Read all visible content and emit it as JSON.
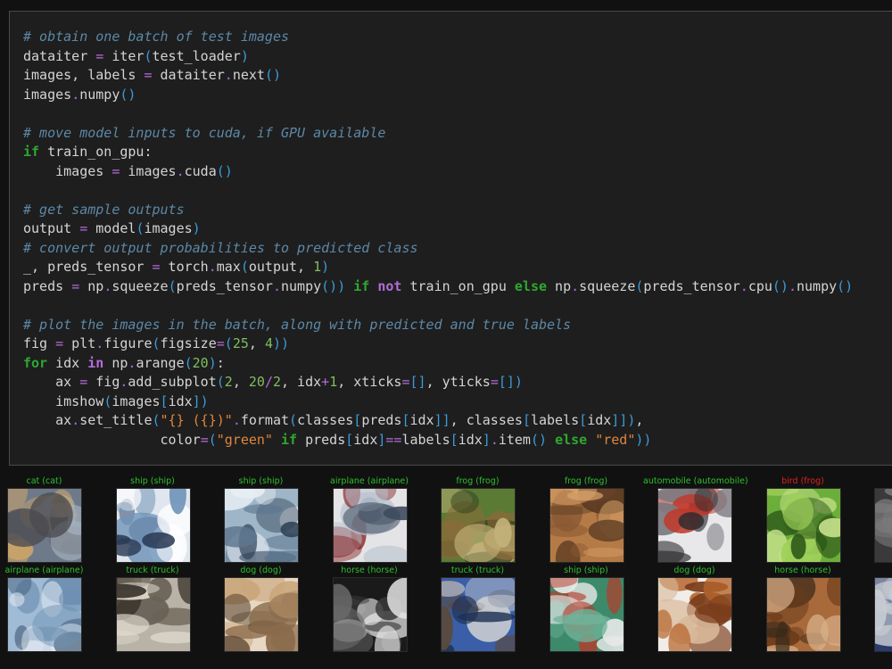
{
  "code_lines": [
    [
      {
        "c": "cm",
        "t": "# obtain one batch of test images"
      }
    ],
    [
      {
        "t": "dataiter "
      },
      {
        "c": "op",
        "t": "="
      },
      {
        "t": " iter"
      },
      {
        "c": "br",
        "t": "("
      },
      {
        "t": "test_loader"
      },
      {
        "c": "br",
        "t": ")"
      }
    ],
    [
      {
        "t": "images, labels "
      },
      {
        "c": "op",
        "t": "="
      },
      {
        "t": " dataiter"
      },
      {
        "c": "op",
        "t": "."
      },
      {
        "t": "next"
      },
      {
        "c": "br",
        "t": "()"
      }
    ],
    [
      {
        "t": "images"
      },
      {
        "c": "op",
        "t": "."
      },
      {
        "t": "numpy"
      },
      {
        "c": "br",
        "t": "()"
      }
    ],
    [
      {
        "t": ""
      }
    ],
    [
      {
        "c": "cm",
        "t": "# move model inputs to cuda, if GPU available"
      }
    ],
    [
      {
        "c": "kw",
        "t": "if"
      },
      {
        "t": " train_on_gpu:"
      }
    ],
    [
      {
        "t": "    images "
      },
      {
        "c": "op",
        "t": "="
      },
      {
        "t": " images"
      },
      {
        "c": "op",
        "t": "."
      },
      {
        "t": "cuda"
      },
      {
        "c": "br",
        "t": "()"
      }
    ],
    [
      {
        "t": ""
      }
    ],
    [
      {
        "c": "cm",
        "t": "# get sample outputs"
      }
    ],
    [
      {
        "t": "output "
      },
      {
        "c": "op",
        "t": "="
      },
      {
        "t": " model"
      },
      {
        "c": "br",
        "t": "("
      },
      {
        "t": "images"
      },
      {
        "c": "br",
        "t": ")"
      }
    ],
    [
      {
        "c": "cm",
        "t": "# convert output probabilities to predicted class"
      }
    ],
    [
      {
        "t": "_, preds_tensor "
      },
      {
        "c": "op",
        "t": "="
      },
      {
        "t": " torch"
      },
      {
        "c": "op",
        "t": "."
      },
      {
        "t": "max"
      },
      {
        "c": "br",
        "t": "("
      },
      {
        "t": "output, "
      },
      {
        "c": "num",
        "t": "1"
      },
      {
        "c": "br",
        "t": ")"
      }
    ],
    [
      {
        "t": "preds "
      },
      {
        "c": "op",
        "t": "="
      },
      {
        "t": " np"
      },
      {
        "c": "op",
        "t": "."
      },
      {
        "t": "squeeze"
      },
      {
        "c": "br",
        "t": "("
      },
      {
        "t": "preds_tensor"
      },
      {
        "c": "op",
        "t": "."
      },
      {
        "t": "numpy"
      },
      {
        "c": "br",
        "t": "())"
      },
      {
        "t": " "
      },
      {
        "c": "kw",
        "t": "if"
      },
      {
        "t": " "
      },
      {
        "c": "kw2",
        "t": "not"
      },
      {
        "t": " train_on_gpu "
      },
      {
        "c": "kw",
        "t": "else"
      },
      {
        "t": " np"
      },
      {
        "c": "op",
        "t": "."
      },
      {
        "t": "squeeze"
      },
      {
        "c": "br",
        "t": "("
      },
      {
        "t": "preds_tensor"
      },
      {
        "c": "op",
        "t": "."
      },
      {
        "t": "cpu"
      },
      {
        "c": "br",
        "t": "()"
      },
      {
        "c": "op",
        "t": "."
      },
      {
        "t": "numpy"
      },
      {
        "c": "br",
        "t": "()"
      }
    ],
    [
      {
        "t": ""
      }
    ],
    [
      {
        "c": "cm",
        "t": "# plot the images in the batch, along with predicted and true labels"
      }
    ],
    [
      {
        "t": "fig "
      },
      {
        "c": "op",
        "t": "="
      },
      {
        "t": " plt"
      },
      {
        "c": "op",
        "t": "."
      },
      {
        "t": "figure"
      },
      {
        "c": "br",
        "t": "("
      },
      {
        "t": "figsize"
      },
      {
        "c": "op",
        "t": "="
      },
      {
        "c": "br",
        "t": "("
      },
      {
        "c": "num",
        "t": "25"
      },
      {
        "t": ", "
      },
      {
        "c": "num",
        "t": "4"
      },
      {
        "c": "br",
        "t": "))"
      }
    ],
    [
      {
        "c": "kw",
        "t": "for"
      },
      {
        "t": " idx "
      },
      {
        "c": "kw2",
        "t": "in"
      },
      {
        "t": " np"
      },
      {
        "c": "op",
        "t": "."
      },
      {
        "t": "arange"
      },
      {
        "c": "br",
        "t": "("
      },
      {
        "c": "num",
        "t": "20"
      },
      {
        "c": "br",
        "t": ")"
      },
      {
        "t": ":"
      }
    ],
    [
      {
        "t": "    ax "
      },
      {
        "c": "op",
        "t": "="
      },
      {
        "t": " fig"
      },
      {
        "c": "op",
        "t": "."
      },
      {
        "t": "add_subplot"
      },
      {
        "c": "br",
        "t": "("
      },
      {
        "c": "num",
        "t": "2"
      },
      {
        "t": ", "
      },
      {
        "c": "num",
        "t": "20"
      },
      {
        "c": "op",
        "t": "/"
      },
      {
        "c": "num",
        "t": "2"
      },
      {
        "t": ", idx"
      },
      {
        "c": "op",
        "t": "+"
      },
      {
        "c": "num",
        "t": "1"
      },
      {
        "t": ", xticks"
      },
      {
        "c": "op",
        "t": "="
      },
      {
        "c": "br",
        "t": "[]"
      },
      {
        "t": ", yticks"
      },
      {
        "c": "op",
        "t": "="
      },
      {
        "c": "br",
        "t": "[])"
      }
    ],
    [
      {
        "t": "    imshow"
      },
      {
        "c": "br",
        "t": "("
      },
      {
        "t": "images"
      },
      {
        "c": "br",
        "t": "["
      },
      {
        "t": "idx"
      },
      {
        "c": "br",
        "t": "])"
      }
    ],
    [
      {
        "t": "    ax"
      },
      {
        "c": "op",
        "t": "."
      },
      {
        "t": "set_title"
      },
      {
        "c": "br",
        "t": "("
      },
      {
        "c": "str",
        "t": "\"{} ({})\""
      },
      {
        "c": "op",
        "t": "."
      },
      {
        "t": "format"
      },
      {
        "c": "br",
        "t": "("
      },
      {
        "t": "classes"
      },
      {
        "c": "br",
        "t": "["
      },
      {
        "t": "preds"
      },
      {
        "c": "br",
        "t": "["
      },
      {
        "t": "idx"
      },
      {
        "c": "br",
        "t": "]]"
      },
      {
        "t": ", classes"
      },
      {
        "c": "br",
        "t": "["
      },
      {
        "t": "labels"
      },
      {
        "c": "br",
        "t": "["
      },
      {
        "t": "idx"
      },
      {
        "c": "br",
        "t": "]])"
      },
      {
        "t": ","
      }
    ],
    [
      {
        "t": "                 color"
      },
      {
        "c": "op",
        "t": "="
      },
      {
        "c": "br",
        "t": "("
      },
      {
        "c": "str",
        "t": "\"green\""
      },
      {
        "t": " "
      },
      {
        "c": "kw",
        "t": "if"
      },
      {
        "t": " preds"
      },
      {
        "c": "br",
        "t": "["
      },
      {
        "t": "idx"
      },
      {
        "c": "br",
        "t": "]"
      },
      {
        "c": "op",
        "t": "=="
      },
      {
        "t": "labels"
      },
      {
        "c": "br",
        "t": "["
      },
      {
        "t": "idx"
      },
      {
        "c": "br",
        "t": "]"
      },
      {
        "c": "op",
        "t": "."
      },
      {
        "t": "item"
      },
      {
        "c": "br",
        "t": "()"
      },
      {
        "t": " "
      },
      {
        "c": "kw",
        "t": "else"
      },
      {
        "t": " "
      },
      {
        "c": "str",
        "t": "\"red\""
      },
      {
        "c": "br",
        "t": "))"
      }
    ]
  ],
  "colors": {
    "correct": "#2ec02e",
    "wrong": "#e02020",
    "background": "#111111",
    "cell_background": "#1e1e1e"
  },
  "thumbnails_row1": [
    {
      "title": "cat (cat)",
      "status": "correct",
      "palette": [
        "#6e7a8a",
        "#c9a36a",
        "#4a4a50",
        "#a8b4c2"
      ]
    },
    {
      "title": "ship (ship)",
      "status": "correct",
      "palette": [
        "#dfe6ee",
        "#6f93b8",
        "#2b3a55",
        "#ffffff"
      ]
    },
    {
      "title": "ship (ship)",
      "status": "correct",
      "palette": [
        "#9fb6c8",
        "#5d7790",
        "#e8eef3",
        "#2f4257"
      ]
    },
    {
      "title": "airplane (airplane)",
      "status": "correct",
      "palette": [
        "#e4e4e6",
        "#8a2b2b",
        "#3d4a5c",
        "#b8c2cf"
      ]
    },
    {
      "title": "frog (frog)",
      "status": "correct",
      "palette": [
        "#5b7a34",
        "#8a6a3a",
        "#c2b27a",
        "#2f3f1c"
      ]
    },
    {
      "title": "frog (frog)",
      "status": "correct",
      "palette": [
        "#b57b46",
        "#8a5a33",
        "#d9a26a",
        "#5a3a22"
      ]
    },
    {
      "title": "automobile (automobile)",
      "status": "correct",
      "palette": [
        "#e8e8ea",
        "#c0392b",
        "#2b2b2e",
        "#7a7a80"
      ]
    },
    {
      "title": "bird (frog)",
      "status": "wrong",
      "palette": [
        "#6cae3a",
        "#9fd05a",
        "#2f5a1a",
        "#c9e38e"
      ]
    }
  ],
  "thumbnails_row2": [
    {
      "title": "airplane (airplane)",
      "status": "correct",
      "palette": [
        "#9fbbd6",
        "#6e8fb0",
        "#dfe8f0",
        "#3c5670"
      ]
    },
    {
      "title": "truck (truck)",
      "status": "correct",
      "palette": [
        "#b9b2a6",
        "#6b6256",
        "#e2dbd0",
        "#3a342c"
      ]
    },
    {
      "title": "dog (dog)",
      "status": "correct",
      "palette": [
        "#e6d8c4",
        "#8a6a4a",
        "#5a4532",
        "#c9a57a"
      ]
    },
    {
      "title": "horse (horse)",
      "status": "correct",
      "palette": [
        "#1a1a1a",
        "#e6e6e6",
        "#6a6a6a",
        "#3a3a3a"
      ]
    },
    {
      "title": "truck (truck)",
      "status": "correct",
      "palette": [
        "#3a5ea8",
        "#c8ccd2",
        "#5a4a3a",
        "#1e2f52"
      ]
    },
    {
      "title": "ship (ship)",
      "status": "correct",
      "palette": [
        "#3d8a6a",
        "#e6e8e8",
        "#b83a2a",
        "#6fb39a"
      ]
    },
    {
      "title": "dog (dog)",
      "status": "correct",
      "palette": [
        "#f0ede8",
        "#b5652c",
        "#7a3c1a",
        "#d8b89a"
      ]
    },
    {
      "title": "horse (horse)",
      "status": "correct",
      "palette": [
        "#a86a3a",
        "#6a3a1a",
        "#d8b08a",
        "#3a2a1a"
      ]
    }
  ],
  "partial_row1": {
    "title": "",
    "palette": [
      "#3a3a3a",
      "#7a7a7a"
    ]
  },
  "partial_row2": {
    "title": "s",
    "status": "correct",
    "palette": [
      "#2a3a6a",
      "#c8ccd2"
    ]
  }
}
